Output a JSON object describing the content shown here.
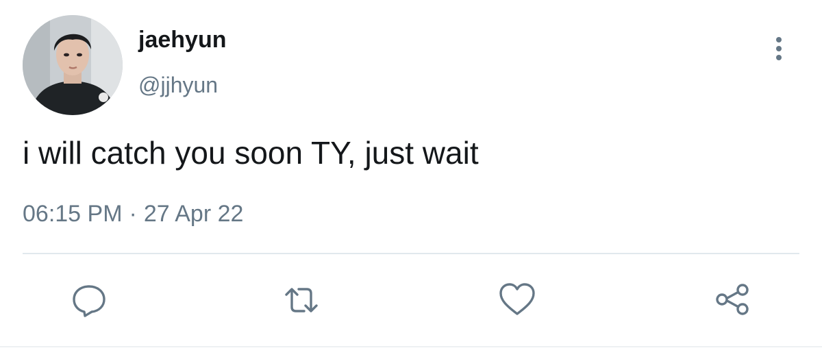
{
  "tweet": {
    "author": {
      "display_name": "jaehyun",
      "handle": "@jjhyun"
    },
    "text": "i will catch you soon TY, just wait",
    "time": "06:15 PM",
    "separator": "·",
    "date": "27 Apr 22"
  },
  "actions": {
    "reply_icon": "reply-icon",
    "retweet_icon": "retweet-icon",
    "like_icon": "heart-icon",
    "share_icon": "share-icon",
    "more_icon": "more-vertical-icon"
  },
  "colors": {
    "text_primary": "#14171a",
    "text_secondary": "#657786",
    "icon_color": "#657786",
    "divider": "#e1e8ed"
  }
}
